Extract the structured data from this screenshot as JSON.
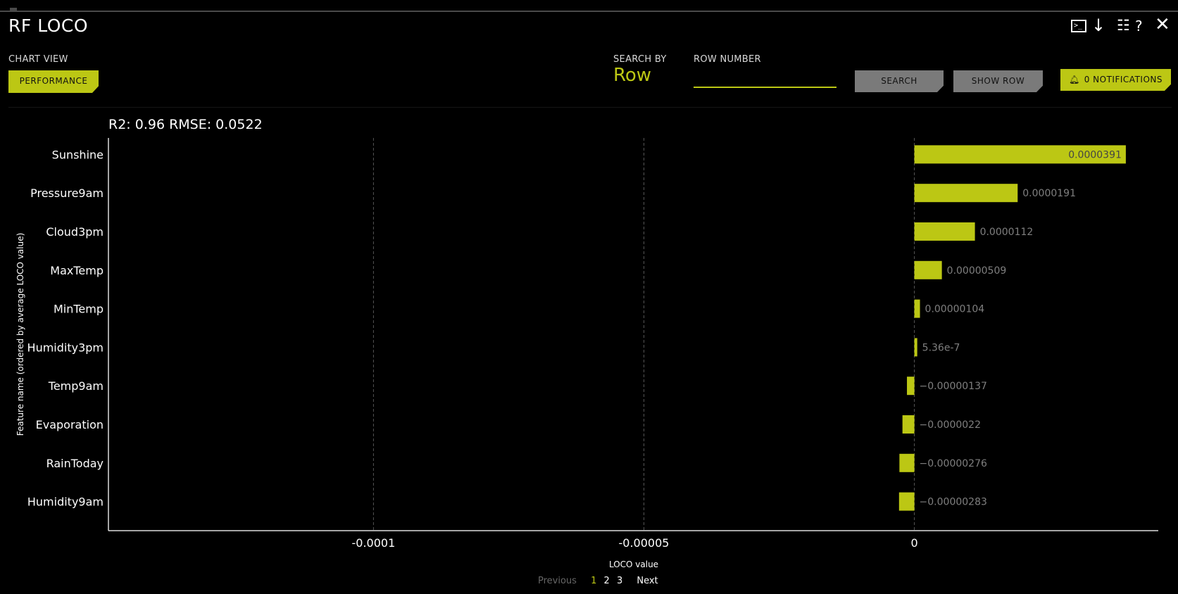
{
  "window": {
    "title": "RF LOCO"
  },
  "toolbar": {
    "icons": [
      "terminal-icon",
      "download-icon",
      "list-icon",
      "help-icon",
      "close-icon"
    ]
  },
  "controls": {
    "chart_view_label": "CHART VIEW",
    "chart_view_button": "PERFORMANCE",
    "search_by_label": "SEARCH BY",
    "search_by_value": "Row",
    "row_number_label": "ROW NUMBER",
    "row_number_value": "",
    "search_button": "SEARCH",
    "show_row_button": "SHOW ROW",
    "notifications_button": "0 NOTIFICATIONS"
  },
  "metrics": {
    "text": "R2: 0.96 RMSE: 0.0522"
  },
  "colors": {
    "accent": "#bcc714",
    "background": "#000000",
    "button_gray": "#7a7a7a"
  },
  "chart_data": {
    "type": "bar",
    "orientation": "horizontal",
    "categories": [
      "Sunshine",
      "Pressure9am",
      "Cloud3pm",
      "MaxTemp",
      "MinTemp",
      "Humidity3pm",
      "Temp9am",
      "Evaporation",
      "RainToday",
      "Humidity9am"
    ],
    "values": [
      3.91e-05,
      1.91e-05,
      1.12e-05,
      5.09e-06,
      1.04e-06,
      5.36e-07,
      -1.37e-06,
      -2.2e-06,
      -2.76e-06,
      -2.83e-06
    ],
    "value_labels": [
      "0.0000391",
      "0.0000191",
      "0.0000112",
      "0.00000509",
      "0.00000104",
      "5.36e-7",
      "−0.00000137",
      "−0.0000022",
      "−0.00000276",
      "−0.00000283"
    ],
    "xlabel": "LOCO value",
    "ylabel": "Feature name (ordered by average LOCO value)",
    "xlim": [
      -0.000149,
      4.51e-05
    ],
    "xticks": [
      -0.0001,
      -5e-05,
      0
    ],
    "xtick_labels": [
      "-0.0001",
      "-0.00005",
      "0"
    ],
    "grid": "vertical dashed",
    "bar_color": "#bcc714"
  },
  "pagination": {
    "previous": "Previous",
    "pages": [
      "1",
      "2",
      "3"
    ],
    "current": "1",
    "next": "Next"
  }
}
